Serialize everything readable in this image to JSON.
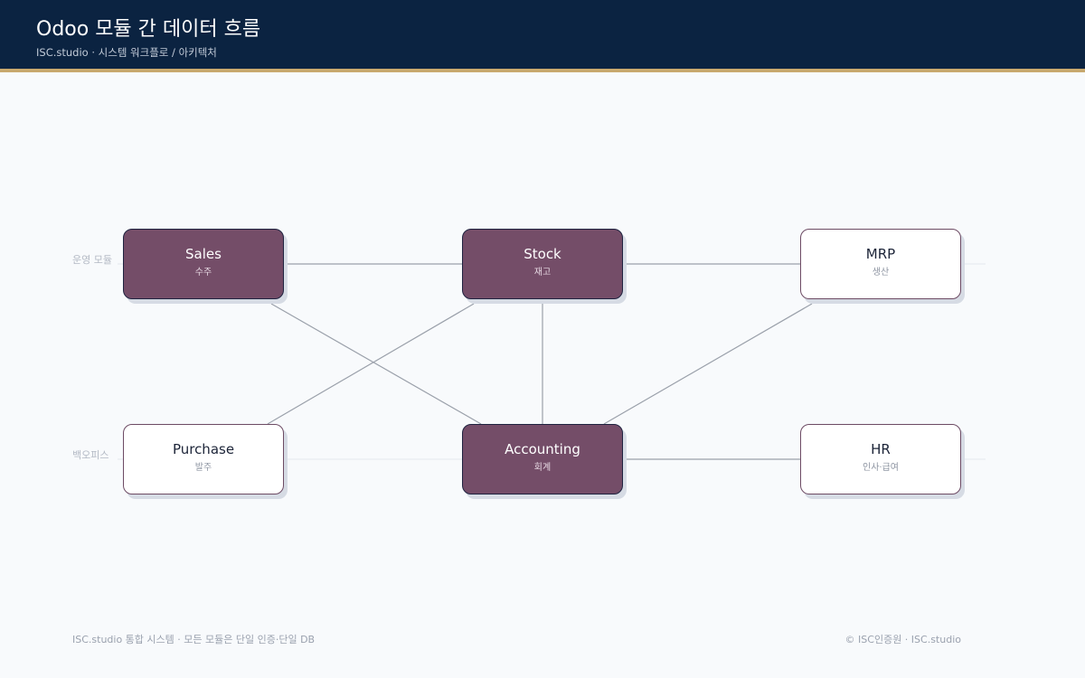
{
  "header": {
    "title": "Odoo 모듈 간 데이터 흐름",
    "subtitle": "ISC.studio · 시스템 워크플로 / 아키텍처"
  },
  "rows": [
    {
      "label": "운영 모듈"
    },
    {
      "label": "백오피스"
    }
  ],
  "modules": [
    {
      "name": "Sales",
      "sub": "수주",
      "core": true
    },
    {
      "name": "Stock",
      "sub": "재고",
      "core": true
    },
    {
      "name": "MRP",
      "sub": "생산",
      "core": false
    },
    {
      "name": "Purchase",
      "sub": "발주",
      "core": false
    },
    {
      "name": "Accounting",
      "sub": "회계",
      "core": true
    },
    {
      "name": "HR",
      "sub": "인사·급여",
      "core": false
    }
  ],
  "connections": [
    [
      "Sales",
      "Stock"
    ],
    [
      "Stock",
      "MRP"
    ],
    [
      "Sales",
      "Accounting"
    ],
    [
      "Stock",
      "Purchase"
    ],
    [
      "Stock",
      "Accounting"
    ],
    [
      "MRP",
      "Accounting"
    ],
    [
      "Accounting",
      "HR"
    ]
  ],
  "footer": {
    "left": "ISC.studio 통합 시스템 · 모든 모듈은 단일 인증·단일 DB",
    "right": "© ISC인증원 · ISC.studio"
  },
  "colors": {
    "header_bg": "#0b2341",
    "accent_rule": "#c9a96e",
    "core_fill": "#744d68",
    "edge": "#9aa0aa"
  }
}
